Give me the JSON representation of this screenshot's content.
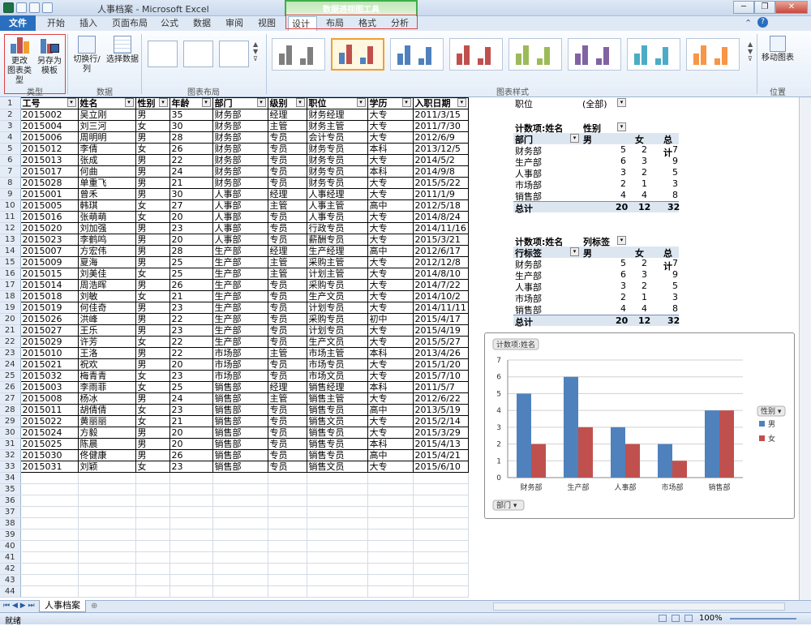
{
  "window": {
    "title": "人事档案 - Microsoft Excel",
    "contextual_title": "数据透视图工具"
  },
  "tabs": [
    "开始",
    "插入",
    "页面布局",
    "公式",
    "数据",
    "审阅",
    "视图",
    "设计",
    "布局",
    "格式",
    "分析"
  ],
  "file_tab": "文件",
  "ribbon": {
    "change_type": "更改\n图表类型",
    "save_template": "另存为\n模板",
    "switch_row_col": "切换行/列",
    "select_data": "选择数据",
    "move_chart": "移动图表",
    "groups": {
      "type": "类型",
      "data": "数据",
      "layout": "图表布局",
      "styles": "图表样式",
      "location": "位置"
    }
  },
  "sheet": {
    "headers": [
      "工号",
      "姓名",
      "性别",
      "年龄",
      "部门",
      "级别",
      "职位",
      "学历",
      "入职日期"
    ],
    "rows": [
      [
        "2015002",
        "吴立刚",
        "男",
        "35",
        "财务部",
        "经理",
        "财务经理",
        "大专",
        "2011/3/15"
      ],
      [
        "2015004",
        "刘三河",
        "女",
        "30",
        "财务部",
        "主管",
        "财务主管",
        "大专",
        "2011/7/30"
      ],
      [
        "2015006",
        "周明明",
        "男",
        "28",
        "财务部",
        "专员",
        "会计专员",
        "大专",
        "2012/6/9"
      ],
      [
        "2015012",
        "李倩",
        "女",
        "26",
        "财务部",
        "专员",
        "财务专员",
        "本科",
        "2013/12/5"
      ],
      [
        "2015013",
        "张成",
        "男",
        "22",
        "财务部",
        "专员",
        "财务专员",
        "大专",
        "2014/5/2"
      ],
      [
        "2015017",
        "何曲",
        "男",
        "24",
        "财务部",
        "专员",
        "财务专员",
        "本科",
        "2014/9/8"
      ],
      [
        "2015028",
        "单重飞",
        "男",
        "21",
        "财务部",
        "专员",
        "财务专员",
        "大专",
        "2015/5/22"
      ],
      [
        "2015001",
        "曾禾",
        "男",
        "30",
        "人事部",
        "经理",
        "人事经理",
        "大专",
        "2011/1/9"
      ],
      [
        "2015005",
        "韩琪",
        "女",
        "27",
        "人事部",
        "主管",
        "人事主管",
        "高中",
        "2012/5/18"
      ],
      [
        "2015016",
        "张萌萌",
        "女",
        "20",
        "人事部",
        "专员",
        "人事专员",
        "大专",
        "2014/8/24"
      ],
      [
        "2015020",
        "刘加强",
        "男",
        "23",
        "人事部",
        "专员",
        "行政专员",
        "大专",
        "2014/11/16"
      ],
      [
        "2015023",
        "李鹤鸣",
        "男",
        "20",
        "人事部",
        "专员",
        "薪酬专员",
        "大专",
        "2015/3/21"
      ],
      [
        "2015007",
        "方宏伟",
        "男",
        "28",
        "生产部",
        "经理",
        "生产经理",
        "高中",
        "2012/6/17"
      ],
      [
        "2015009",
        "夏海",
        "男",
        "25",
        "生产部",
        "主管",
        "采购主管",
        "大专",
        "2012/12/8"
      ],
      [
        "2015015",
        "刘美佳",
        "女",
        "25",
        "生产部",
        "主管",
        "计划主管",
        "大专",
        "2014/8/10"
      ],
      [
        "2015014",
        "周浩晖",
        "男",
        "26",
        "生产部",
        "专员",
        "采购专员",
        "大专",
        "2014/7/22"
      ],
      [
        "2015018",
        "刘敏",
        "女",
        "21",
        "生产部",
        "专员",
        "生产文员",
        "大专",
        "2014/10/2"
      ],
      [
        "2015019",
        "何佳奇",
        "男",
        "23",
        "生产部",
        "专员",
        "计划专员",
        "大专",
        "2014/11/11"
      ],
      [
        "2015026",
        "洪峰",
        "男",
        "22",
        "生产部",
        "专员",
        "采购专员",
        "初中",
        "2015/4/17"
      ],
      [
        "2015027",
        "王乐",
        "男",
        "23",
        "生产部",
        "专员",
        "计划专员",
        "大专",
        "2015/4/19"
      ],
      [
        "2015029",
        "许芳",
        "女",
        "22",
        "生产部",
        "专员",
        "生产文员",
        "大专",
        "2015/5/27"
      ],
      [
        "2015010",
        "王洛",
        "男",
        "22",
        "市场部",
        "主管",
        "市场主管",
        "本科",
        "2013/4/26"
      ],
      [
        "2015021",
        "祝欢",
        "男",
        "20",
        "市场部",
        "专员",
        "市场专员",
        "大专",
        "2015/1/20"
      ],
      [
        "2015032",
        "梅青青",
        "女",
        "23",
        "市场部",
        "专员",
        "市场文员",
        "大专",
        "2015/7/10"
      ],
      [
        "2015003",
        "李雨菲",
        "女",
        "25",
        "销售部",
        "经理",
        "销售经理",
        "本科",
        "2011/5/7"
      ],
      [
        "2015008",
        "杨冰",
        "男",
        "24",
        "销售部",
        "主管",
        "销售主管",
        "大专",
        "2012/6/22"
      ],
      [
        "2015011",
        "胡倩倩",
        "女",
        "23",
        "销售部",
        "专员",
        "销售专员",
        "高中",
        "2013/5/19"
      ],
      [
        "2015022",
        "黄丽丽",
        "女",
        "21",
        "销售部",
        "专员",
        "销售文员",
        "大专",
        "2015/2/14"
      ],
      [
        "2015024",
        "方毅",
        "男",
        "20",
        "销售部",
        "专员",
        "销售专员",
        "大专",
        "2015/3/29"
      ],
      [
        "2015025",
        "陈晨",
        "男",
        "20",
        "销售部",
        "专员",
        "销售专员",
        "本科",
        "2015/4/13"
      ],
      [
        "2015030",
        "佟健康",
        "男",
        "26",
        "销售部",
        "专员",
        "销售专员",
        "高中",
        "2015/4/21"
      ],
      [
        "2015031",
        "刘颖",
        "女",
        "23",
        "销售部",
        "专员",
        "销售文员",
        "大专",
        "2015/6/10"
      ]
    ],
    "extra_rows": [
      "34",
      "35",
      "36",
      "37",
      "38",
      "39",
      "40",
      "41",
      "42",
      "43",
      "44"
    ]
  },
  "pivot1": {
    "filter_label": "职位",
    "filter_value": "(全部)",
    "title": "计数项:姓名",
    "col_field": "性别",
    "row_field": "部门",
    "cols": [
      "男",
      "女",
      "总计"
    ],
    "rows": [
      [
        "财务部",
        "5",
        "2",
        "7"
      ],
      [
        "生产部",
        "6",
        "3",
        "9"
      ],
      [
        "人事部",
        "3",
        "2",
        "5"
      ],
      [
        "市场部",
        "2",
        "1",
        "3"
      ],
      [
        "销售部",
        "4",
        "4",
        "8"
      ]
    ],
    "total": [
      "总计",
      "20",
      "12",
      "32"
    ]
  },
  "pivot2": {
    "title": "计数项:姓名",
    "col_field": "列标签",
    "row_field": "行标签",
    "cols": [
      "男",
      "女",
      "总计"
    ],
    "rows": [
      [
        "财务部",
        "5",
        "2",
        "7"
      ],
      [
        "生产部",
        "6",
        "3",
        "9"
      ],
      [
        "人事部",
        "3",
        "2",
        "5"
      ],
      [
        "市场部",
        "2",
        "1",
        "3"
      ],
      [
        "销售部",
        "4",
        "4",
        "8"
      ]
    ],
    "total": [
      "总计",
      "20",
      "12",
      "32"
    ]
  },
  "chart_data": {
    "type": "bar",
    "title": "计数项:姓名",
    "categories": [
      "财务部",
      "生产部",
      "人事部",
      "市场部",
      "销售部"
    ],
    "series": [
      {
        "name": "男",
        "values": [
          5,
          6,
          3,
          2,
          4
        ],
        "color": "#4f81bd"
      },
      {
        "name": "女",
        "values": [
          2,
          3,
          2,
          1,
          4
        ],
        "color": "#c0504d"
      }
    ],
    "ylim": [
      0,
      7
    ],
    "yticks": [
      "0",
      "1",
      "2",
      "3",
      "4",
      "5",
      "6",
      "7"
    ],
    "legend_title": "性别",
    "axis_field": "部门",
    "legend": "right",
    "grid": true
  },
  "sheet_tab": "人事档案",
  "status": {
    "ready": "就绪",
    "zoom": "100%"
  }
}
